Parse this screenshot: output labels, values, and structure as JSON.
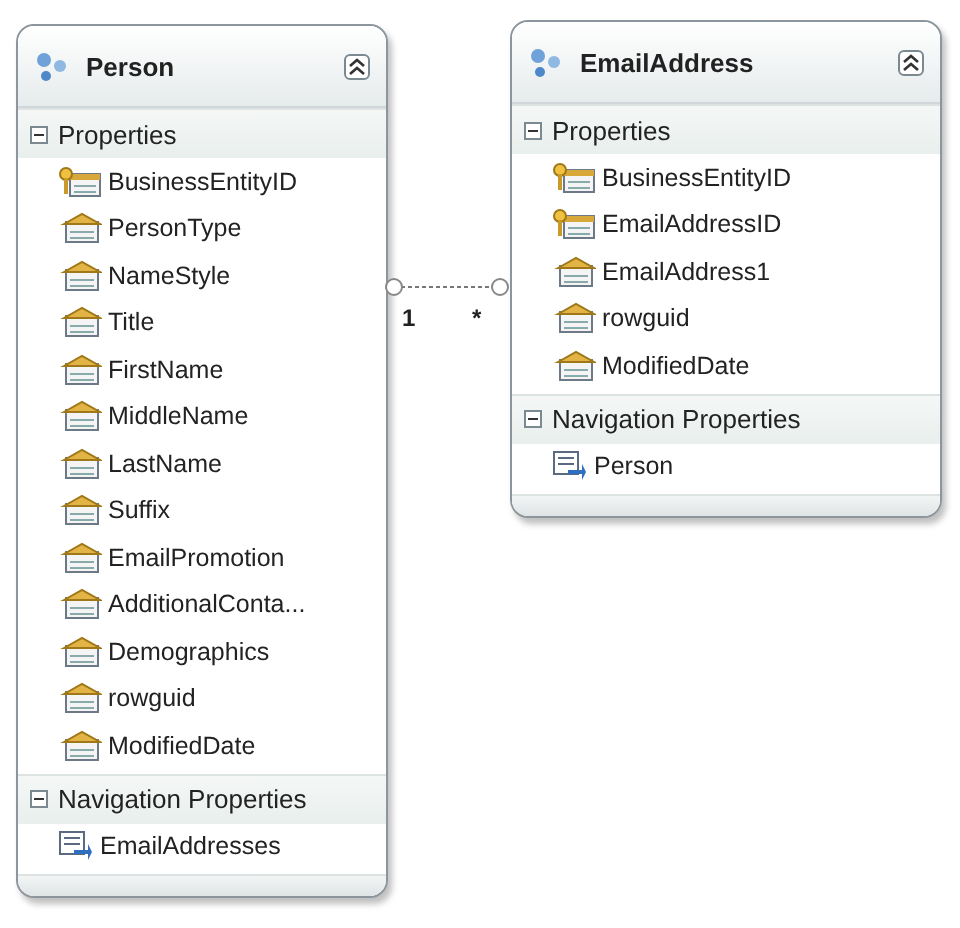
{
  "entities": [
    {
      "name": "Person",
      "sections": [
        {
          "title": "Properties",
          "expanded": true,
          "items": [
            {
              "name": "BusinessEntityID",
              "kind": "key"
            },
            {
              "name": "PersonType",
              "kind": "scalar"
            },
            {
              "name": "NameStyle",
              "kind": "scalar"
            },
            {
              "name": "Title",
              "kind": "scalar"
            },
            {
              "name": "FirstName",
              "kind": "scalar"
            },
            {
              "name": "MiddleName",
              "kind": "scalar"
            },
            {
              "name": "LastName",
              "kind": "scalar"
            },
            {
              "name": "Suffix",
              "kind": "scalar"
            },
            {
              "name": "EmailPromotion",
              "kind": "scalar"
            },
            {
              "name": "AdditionalConta...",
              "kind": "scalar"
            },
            {
              "name": "Demographics",
              "kind": "scalar"
            },
            {
              "name": "rowguid",
              "kind": "scalar"
            },
            {
              "name": "ModifiedDate",
              "kind": "scalar"
            }
          ]
        },
        {
          "title": "Navigation Properties",
          "expanded": true,
          "items": [
            {
              "name": "EmailAddresses",
              "kind": "navigation"
            }
          ]
        }
      ]
    },
    {
      "name": "EmailAddress",
      "sections": [
        {
          "title": "Properties",
          "expanded": true,
          "items": [
            {
              "name": "BusinessEntityID",
              "kind": "key"
            },
            {
              "name": "EmailAddressID",
              "kind": "key"
            },
            {
              "name": "EmailAddress1",
              "kind": "scalar"
            },
            {
              "name": "rowguid",
              "kind": "scalar"
            },
            {
              "name": "ModifiedDate",
              "kind": "scalar"
            }
          ]
        },
        {
          "title": "Navigation Properties",
          "expanded": true,
          "items": [
            {
              "name": "Person",
              "kind": "navigation"
            }
          ]
        }
      ]
    }
  ],
  "association": {
    "source_multiplicity": "1",
    "target_multiplicity": "*"
  }
}
